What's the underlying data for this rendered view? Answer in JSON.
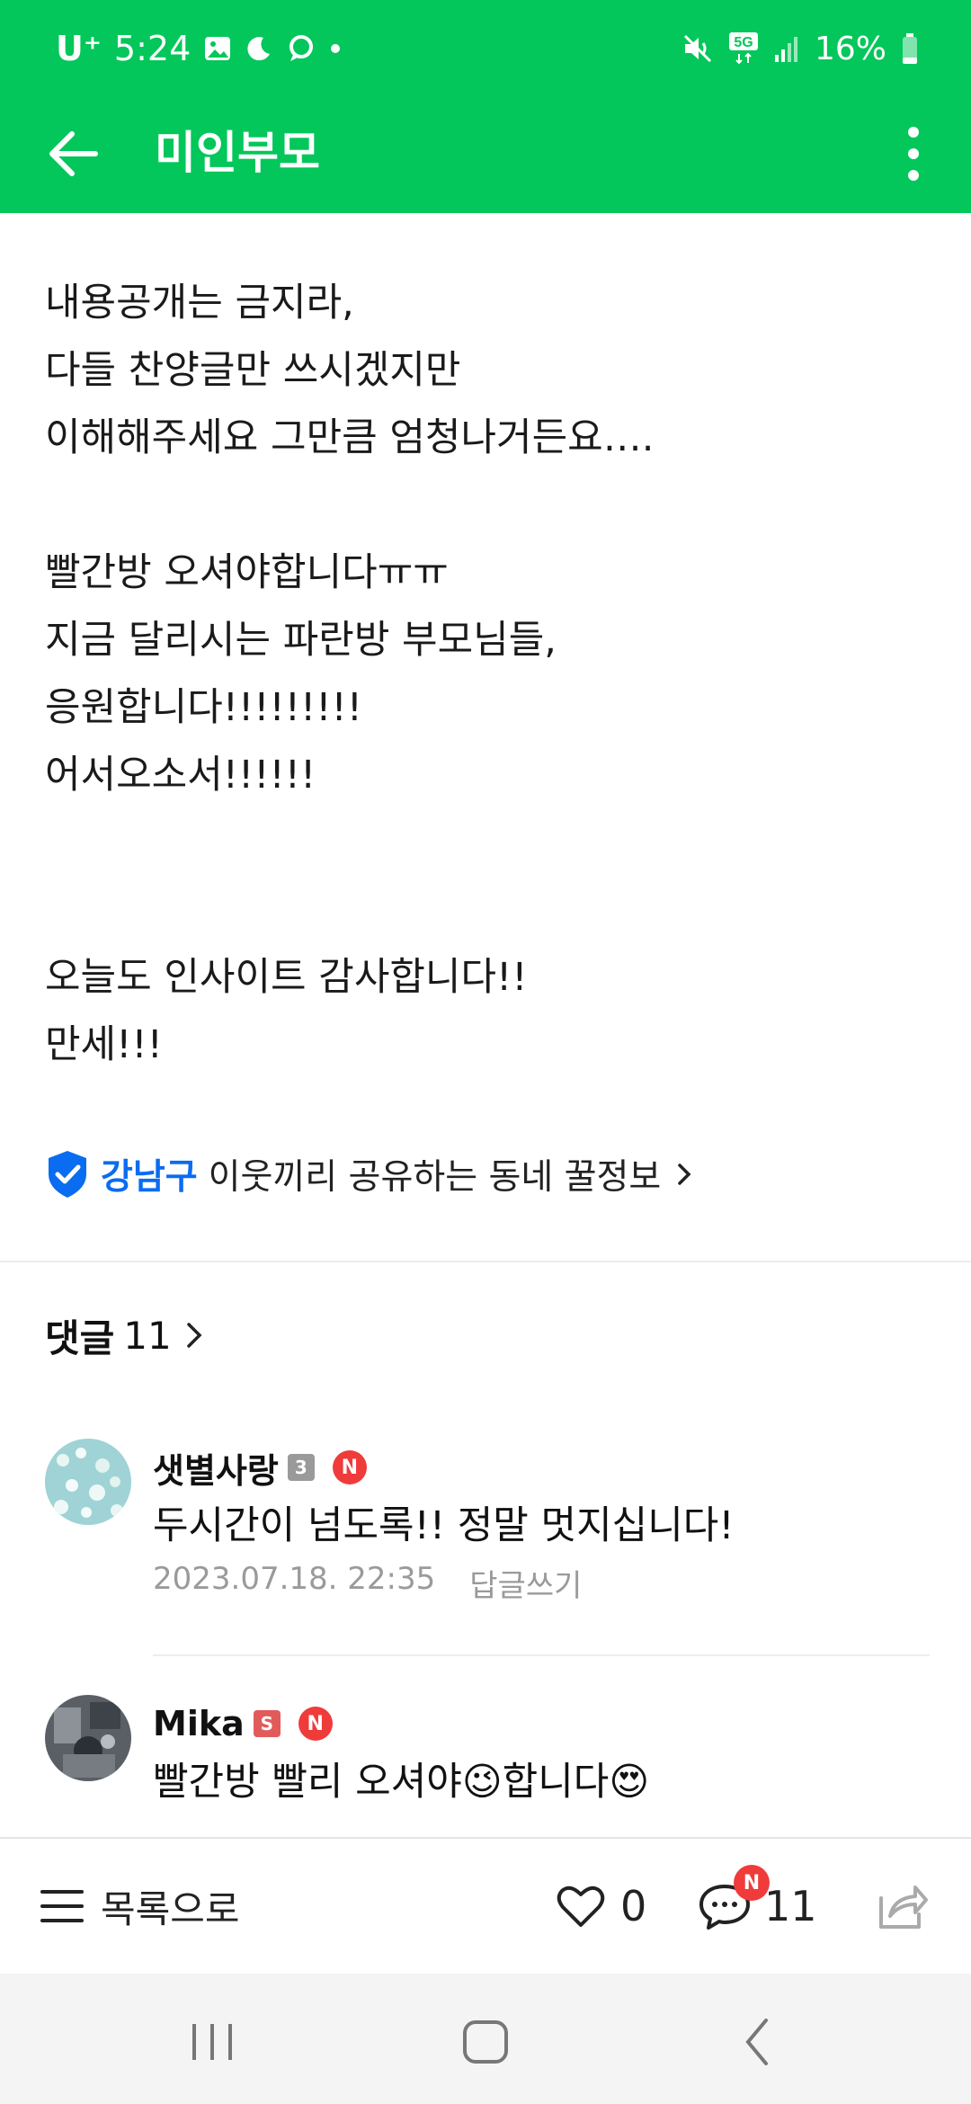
{
  "status_bar": {
    "carrier": "U⁺",
    "time": "5:24",
    "battery": "16%",
    "left_icons": [
      "image-icon",
      "moon-icon",
      "chat-bubble-icon",
      "dot-icon"
    ],
    "right_icons": [
      "mute-icon",
      "5g-icon",
      "signal-icon",
      "battery-icon"
    ]
  },
  "app_bar": {
    "title": "미인부모",
    "back_icon": "arrow-left-icon",
    "menu_icon": "more-vertical-icon"
  },
  "post": {
    "paragraphs": [
      "내용공개는 금지라,\n다들 찬양글만 쓰시겠지만\n이해해주세요 그만큼 엄청나거든요….",
      "빨간방 오셔야합니다ㅠㅠ\n지금 달리시는 파란방 부모님들,\n응원합니다!!!!!!!!!\n어서오소서!!!!!!",
      "오늘도 인사이트 감사합니다!!\n만세!!!"
    ]
  },
  "topic": {
    "region": "강남구",
    "text": "이웃끼리 공유하는 동네 꿀정보",
    "accent": "#0a6cf0"
  },
  "comments_header": {
    "label": "댓글",
    "count": "11"
  },
  "comments": [
    {
      "nickname": "샛별사랑",
      "level_badge": "3",
      "new_badge": "N",
      "text": "두시간이 넘도록!! 정말 멋지십니다!",
      "date": "2023.07.18. 22:35",
      "reply_label": "답글쓰기"
    },
    {
      "nickname": "Mika",
      "level_badge": "S",
      "new_badge": "N",
      "text_before": "빨간방 빨리 오셔야",
      "emoji1": "😉",
      "text_mid": "합니다",
      "emoji2": "😍"
    }
  ],
  "bottom_bar": {
    "list_label": "목록으로",
    "like_count": "0",
    "comment_count": "11",
    "comment_badge": "N"
  },
  "colors": {
    "brand_green": "#03c75a",
    "badge_red": "#f03b3b"
  }
}
